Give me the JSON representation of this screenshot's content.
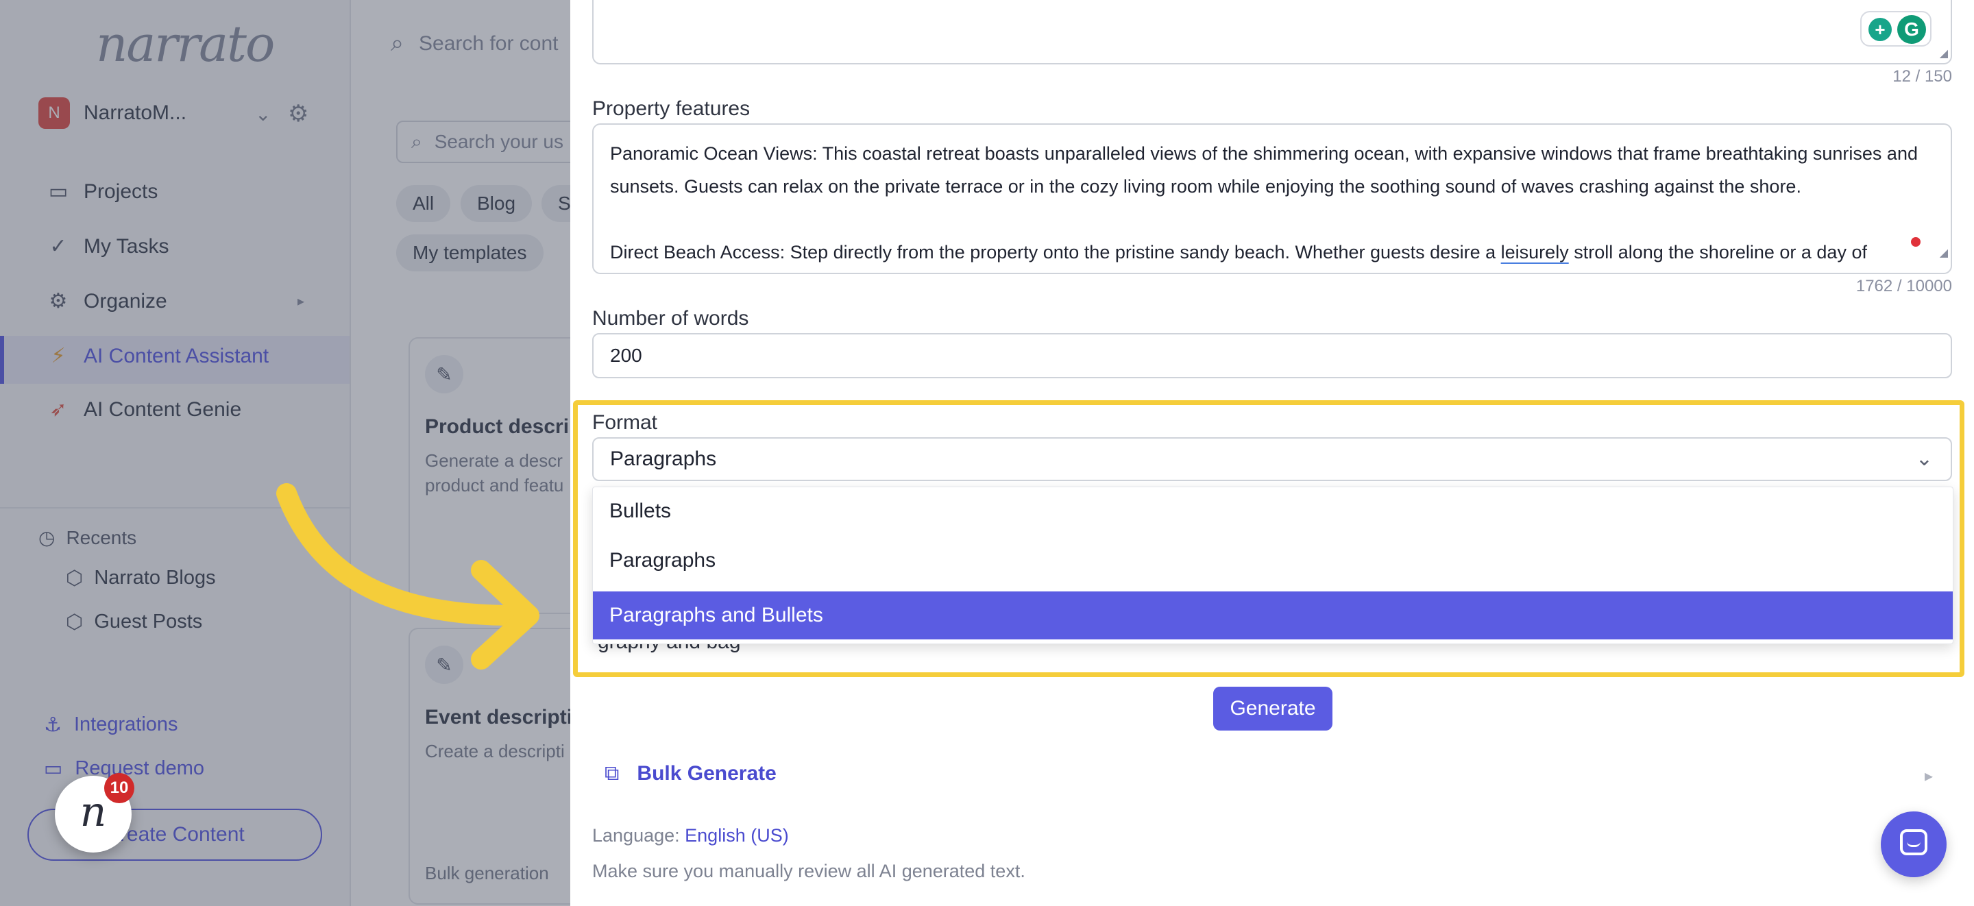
{
  "sidebar": {
    "logo": "narrato",
    "workspace_initial": "N",
    "workspace_name": "NarratoM...",
    "nav": [
      {
        "label": "Projects"
      },
      {
        "label": "My Tasks"
      },
      {
        "label": "Organize"
      },
      {
        "label": "AI Content Assistant"
      },
      {
        "label": "AI Content Genie"
      }
    ],
    "recents_heading": "Recents",
    "recents": [
      "Narrato Blogs",
      "Guest Posts"
    ],
    "links": [
      "Integrations",
      "Request demo"
    ],
    "create_button": "Create Content",
    "notification_count": "10"
  },
  "main": {
    "search_placeholder": "Search for cont",
    "template_search_placeholder": "Search your us",
    "chips": [
      "All",
      "Blog",
      "S",
      "My templates"
    ],
    "cards": [
      {
        "title": "Product descrip",
        "desc": "Generate a descr product and featu",
        "footer": ""
      },
      {
        "title": "Event descriptio",
        "desc": "Create a descripti",
        "footer": "Bulk generation"
      }
    ]
  },
  "form": {
    "top_counter": "12 / 150",
    "features_label": "Property features",
    "features_paragraphs": [
      "Panoramic Ocean Views: This coastal retreat boasts unparalleled views of the shimmering ocean, with expansive windows that frame breathtaking sunrises and sunsets. Guests can relax on the private terrace or in the cozy living room while enjoying the soothing sound of waves crashing against the shore.",
      "Direct Beach Access: Step directly from the property onto the pristine sandy beach. Whether guests desire a leisurely stroll along the shoreline or a day of"
    ],
    "features_counter": "1762 / 10000",
    "words_label": "Number of words",
    "words_value": "200",
    "format_label": "Format",
    "format_selected": "Paragraphs",
    "format_options": [
      "Bullets",
      "Paragraphs",
      "Paragraphs and Bullets"
    ],
    "format_highlighted": "Paragraphs and Bullets",
    "hidden_row_fragment": "graphy  and  bag",
    "generate_button": "Generate",
    "bulk_generate": "Bulk Generate",
    "language_label": "Language:",
    "language_value": "English (US)",
    "review_note": "Make sure you manually review all AI generated text."
  },
  "colors": {
    "accent": "#5b5ce2",
    "highlight_frame": "#f5cd3a",
    "arrow": "#f5cd3a"
  }
}
